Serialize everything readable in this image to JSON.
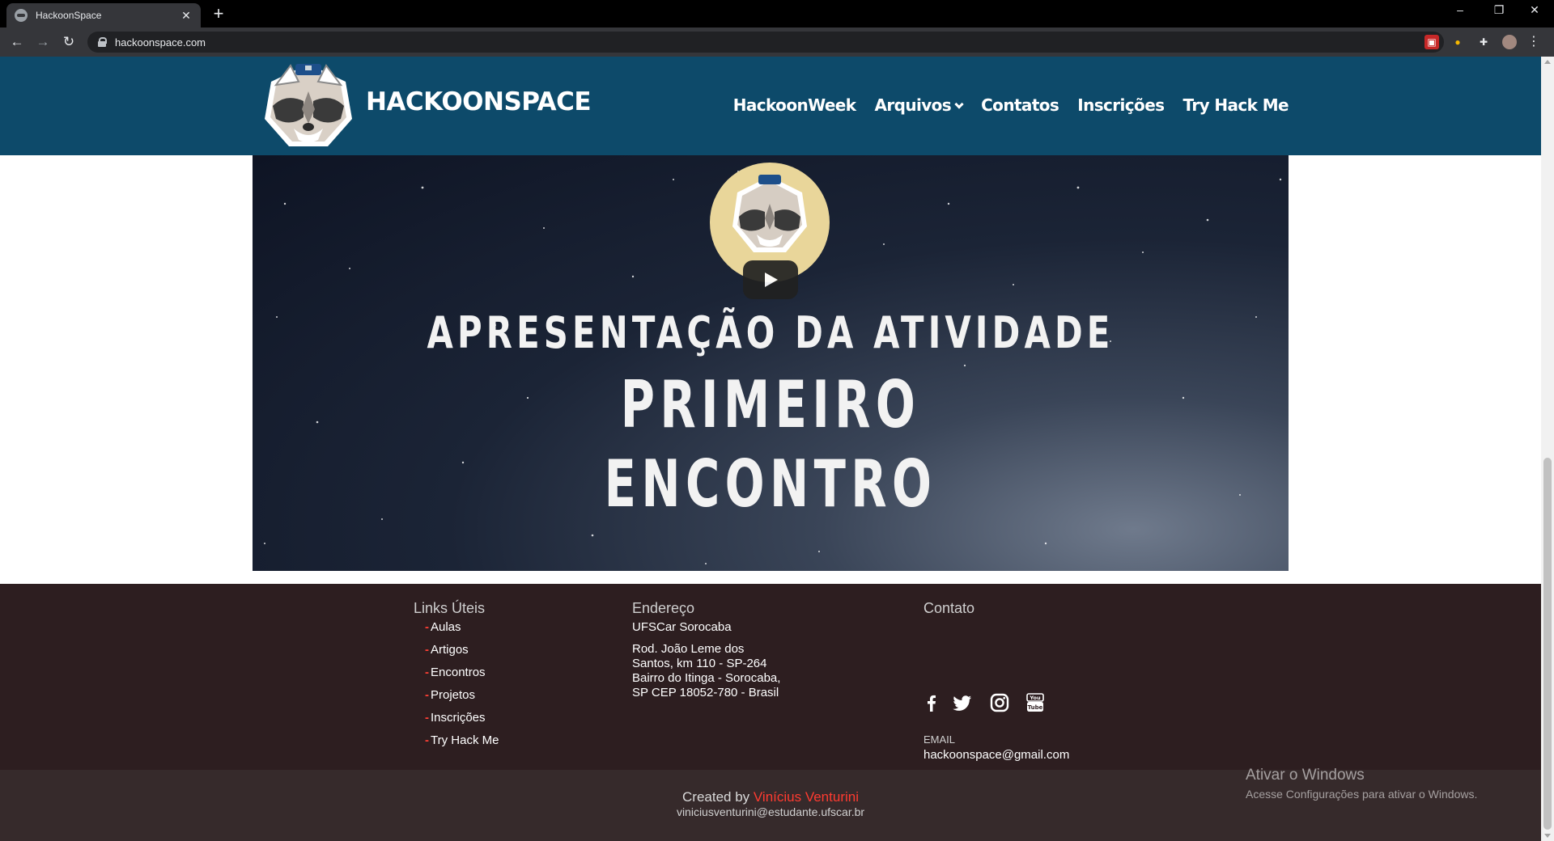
{
  "browser": {
    "tab_title": "HackoonSpace",
    "tab_close": "✕",
    "new_tab": "+",
    "url": "hackoonspace.com",
    "window_controls": {
      "minimize": "–",
      "restore": "❐",
      "close": "✕"
    }
  },
  "header": {
    "brand": "HACKOONSPACE",
    "nav": [
      {
        "label": "HackoonWeek"
      },
      {
        "label": "Arquivos"
      },
      {
        "label": "Contatos"
      },
      {
        "label": "Inscrições"
      },
      {
        "label": "Try Hack Me"
      }
    ]
  },
  "video": {
    "line1": "APRESENTAÇÃO DA ATIVIDADE",
    "line2": "PRIMEIRO",
    "line3": "ENCONTRO"
  },
  "footer": {
    "links_title": "Links Úteis",
    "links": [
      "Aulas",
      "Artigos",
      "Encontros",
      "Projetos",
      "Inscrições",
      "Try Hack Me"
    ],
    "link_dash": "-",
    "address_title": "Endereço",
    "address_name": "UFSCar Sorocaba",
    "address_lines": [
      "Rod. João Leme dos",
      "Santos, km 110 - SP-264",
      "Bairro do Itinga - Sorocaba,",
      "SP CEP 18052-780 - Brasil"
    ],
    "contact_title": "Contato",
    "social_icons": [
      "facebook-icon",
      "twitter-icon",
      "instagram-icon",
      "youtube-icon"
    ],
    "email_label": "EMAIL",
    "email": "hackoonspace@gmail.com",
    "created_prefix": "Created by ",
    "created_author": "Vinícius Venturini",
    "created_email": "viniciusventurini@estudante.ufscar.br"
  },
  "watermark": {
    "title": "Ativar o Windows",
    "subtitle": "Acesse Configurações para ativar o Windows."
  },
  "colors": {
    "header_bg": "#0d4a6a",
    "footer_bg": "#2d1e20",
    "accent": "#ff3b30"
  }
}
